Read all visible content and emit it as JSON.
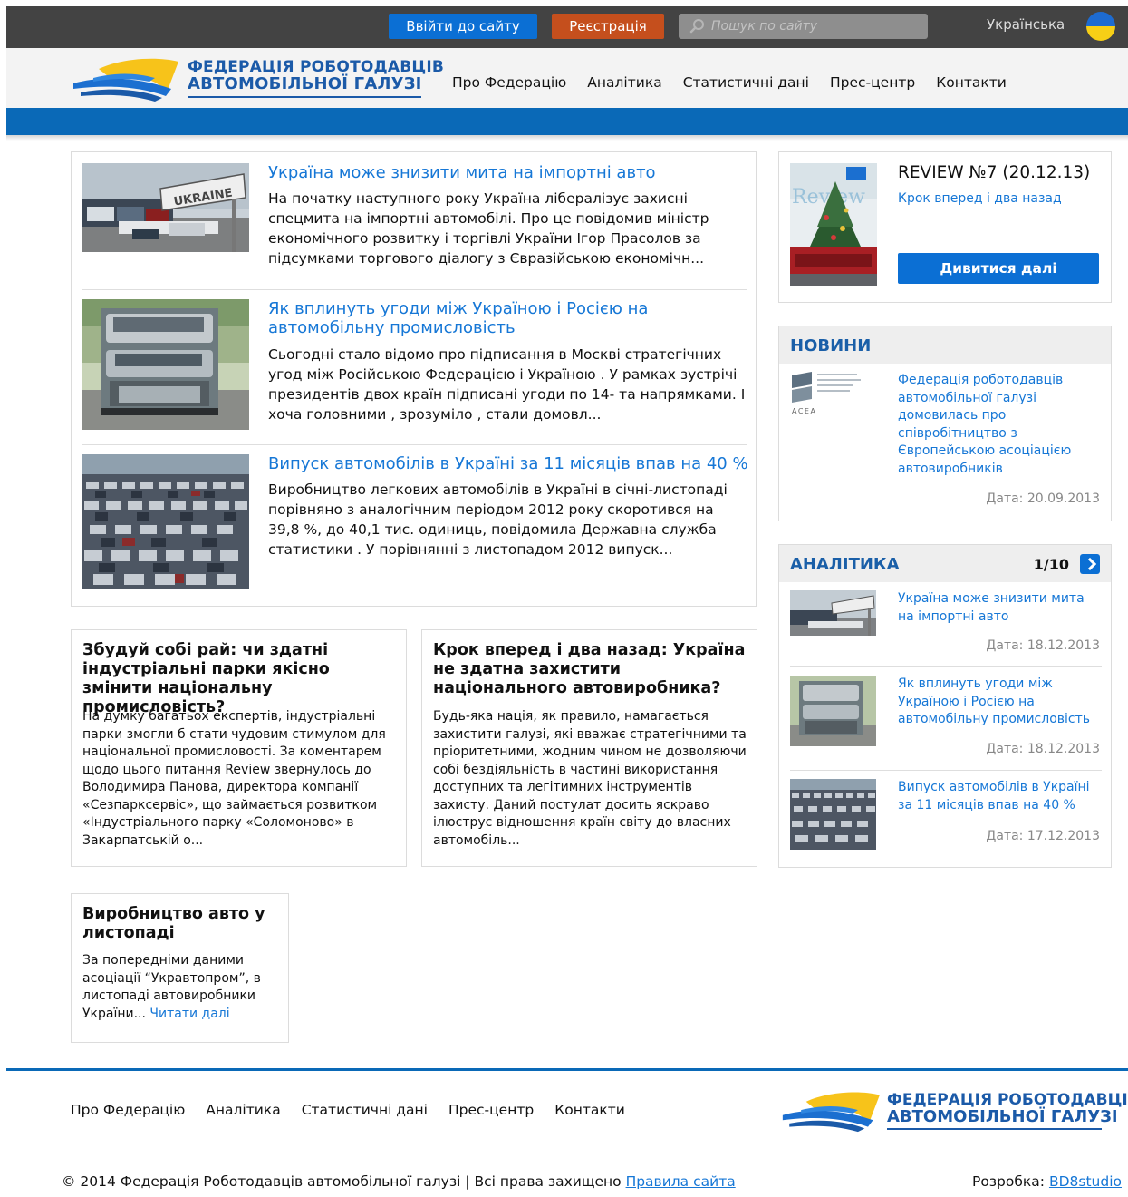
{
  "topbar": {
    "login_label": "Ввійти до сайту",
    "register_label": "Реєстрація",
    "search_placeholder": "Пошук по сайту",
    "language": "Українська"
  },
  "header": {
    "logo_line1": "ФЕДЕРАЦІЯ РОБОТОДАВЦІВ",
    "logo_line2": "АВТОМОБІЛЬНОЇ ГАЛУЗІ",
    "nav": [
      "Про Федерацію",
      "Аналітика",
      "Статистичні дані",
      "Прес-центр",
      "Контакти"
    ]
  },
  "featured": [
    {
      "title": "Україна може знизити мита на імпортні авто",
      "excerpt": "На початку наступного року Україна лібералізує захисні спецмита на імпортні автомобілі. Про це повідомив міністр економічного розвитку і торгівлі України Ігор Прасолов за підсумками торгового діалогу з Євразійською економічн...",
      "image_sign": "UKRAINE"
    },
    {
      "title": "Як вплинуть угоди між Україною і Росією на автомобільну промисловість",
      "excerpt": "Сьогодні стало відомо про підписання в Москві стратегічних угод між Російською Федерацією і Україною . У рамках зустрічі президентів двох країн підписані угоди по 14- та напрямками. І хоча головними , зрозуміло , стали домовл..."
    },
    {
      "title": "Випуск автомобілів в Україні за 11 місяців впав на 40 %",
      "excerpt": "Виробництво легкових автомобілів в Україні в січні-листопаді порівняно з аналогічним періодом 2012 року скоротився на 39,8 %, до 40,1 тис. одиниць, повідомила Державна служба статистики . У порівнянні з листопадом 2012 випуск..."
    }
  ],
  "cards": [
    {
      "title": "Збудуй собі рай: чи здатні індустріальні парки якісно змінити національну промисловість?",
      "excerpt": "На думку багатьох експертів, індустріальні парки змогли б стати чудовим стимулом для національної промисловості. За коментарем щодо цього питання Review звернулось до Володимира Панова, директора компанії «Сезпарксервіс», що займається розвитком «Індустріального парку «Соломоново» в Закарпатській о..."
    },
    {
      "title": "Крок вперед і два назад: Україна не здатна захистити національного автовиробника?",
      "excerpt": "Будь-яка нація, як правило, намагається захистити галузі, які вважає стратегічними та пріоритетними, жодним чином не дозволяючи собі бездіяльність в частині використання доступних та легітимних інструментів захисту. Даний постулат досить яскраво ілюструє відношення країн світу до власних автомобіль..."
    },
    {
      "title": "Виробництво авто у листопаді",
      "excerpt": "За попередніми даними асоціації “Укравтопром”, в листопаді автовиробники України...",
      "read_more": "Читати далі"
    }
  ],
  "review": {
    "title": "REVIEW №7 (20.12.13)",
    "subtitle": "Крок вперед і два назад",
    "button": "Дивитися далі",
    "cover_word": "Review"
  },
  "news": {
    "heading": "НОВИНИ",
    "item_text": "Федерація роботодавців автомобільної галузі домовилась про співробітництво з Європейською асоціацією автовиробників",
    "date": "Дата: 20.09.2013",
    "logo_text": "ACEA"
  },
  "analytics": {
    "heading": "АНАЛІТИКА",
    "pager": "1/10",
    "items": [
      {
        "title": "Україна може знизити мита на імпортні авто",
        "date": "Дата: 18.12.2013"
      },
      {
        "title": "Як вплинуть угоди між Україною і Росією на автомобільну промисловість",
        "date": "Дата: 18.12.2013"
      },
      {
        "title": "Випуск автомобілів в Україні за 11 місяців впав на 40 %",
        "date": "Дата: 17.12.2013"
      }
    ]
  },
  "footer": {
    "nav": [
      "Про Федерацію",
      "Аналітика",
      "Статистичні дані",
      "Прес-центр",
      "Контакти"
    ],
    "copyright": "© 2014 Федерація Роботодавців автомобільної галузі | Всі права захищено",
    "rules_link": "Правила сайта",
    "credit_label": "Розробка:",
    "credit_link": "BD8studio"
  },
  "colors": {
    "topbar": "#434343",
    "accent_blue": "#0b6fd4",
    "register_orange": "#c54f1d",
    "link_blue": "#1677d6",
    "brand_blue": "#1b5aa8"
  }
}
